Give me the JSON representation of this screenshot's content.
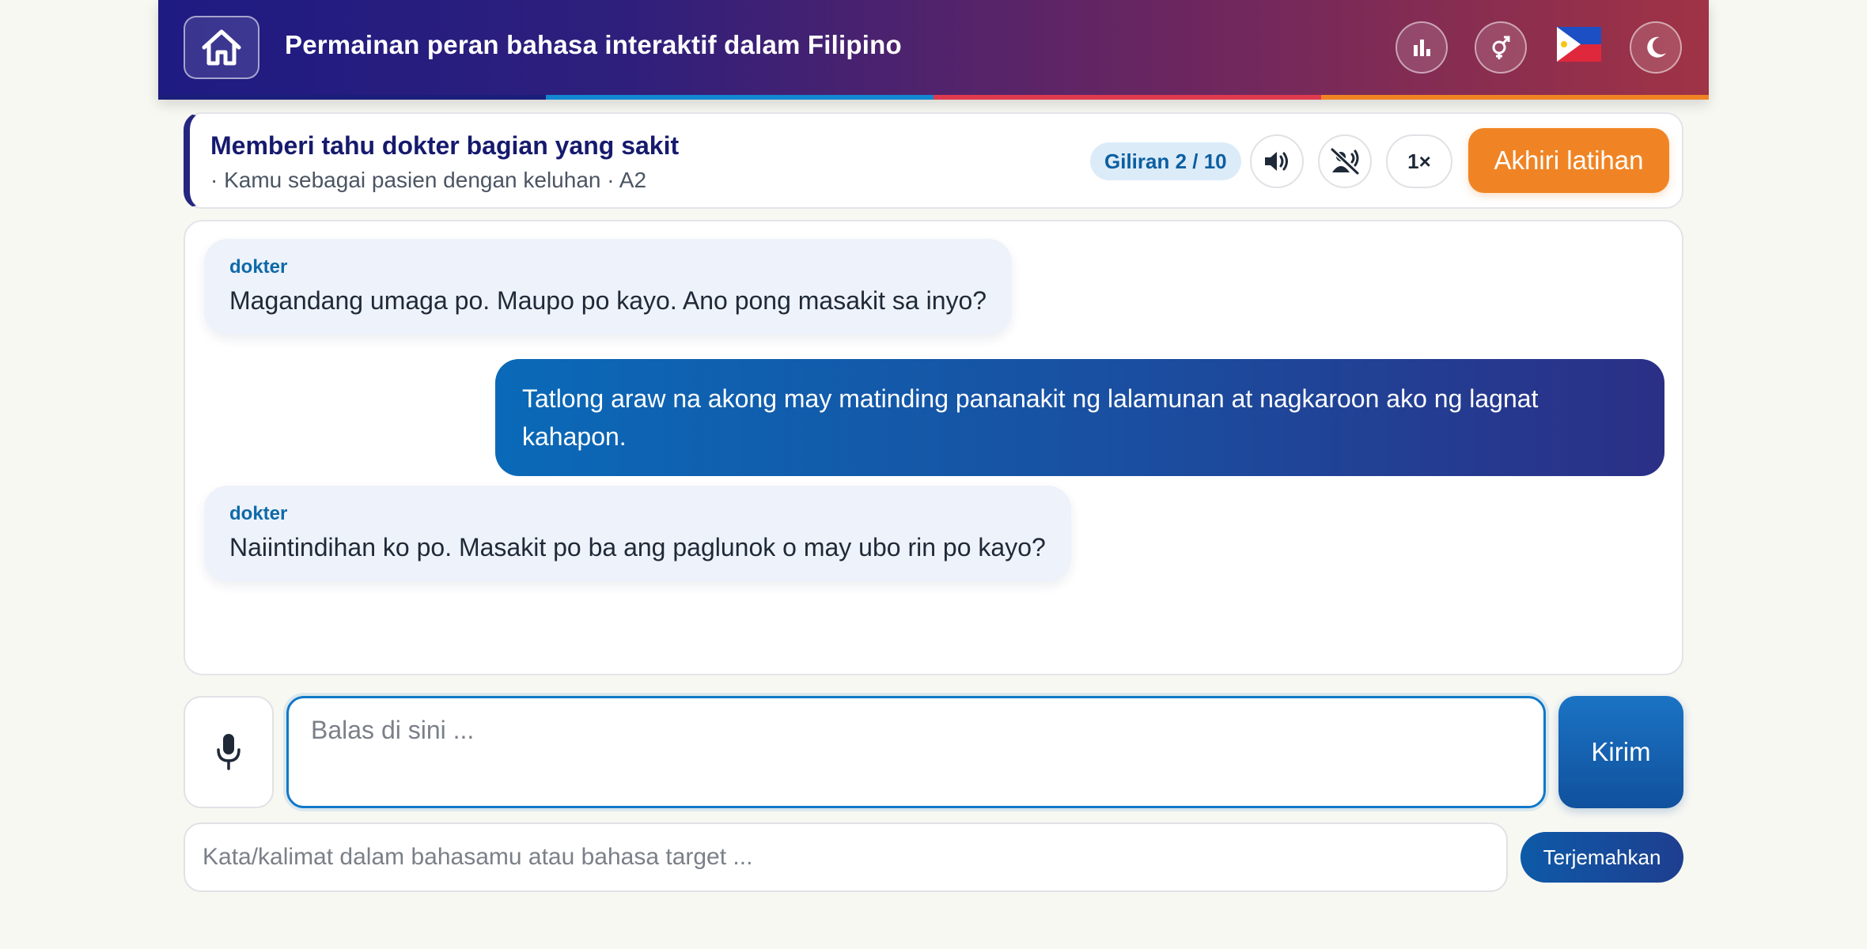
{
  "header": {
    "title": "Permainan peran bahasa interaktif dalam Filipino",
    "icons": [
      "home-icon",
      "bar-chart-icon",
      "gender-icon",
      "philippines-flag-icon",
      "moon-icon"
    ],
    "stripe_colors": [
      "#1c1f7a",
      "#1387d1",
      "#e03a4e",
      "#f08424"
    ]
  },
  "scenario": {
    "title": "Memberi tahu dokter bagian yang sakit",
    "subtitle": "· Kamu sebagai pasien dengan keluhan · A2",
    "turn": "Giliran 2 / 10",
    "speed": "1×",
    "end_label": "Akhiri latihan"
  },
  "chat": {
    "messages": [
      {
        "role": "bot",
        "speaker": "dokter",
        "text": "Magandang umaga po. Maupo po kayo. Ano pong masakit sa inyo?"
      },
      {
        "role": "user",
        "text": "Tatlong araw na akong may matinding pananakit ng lalamunan at nagkaroon ako ng lagnat kahapon."
      },
      {
        "role": "bot",
        "speaker": "dokter",
        "text": "Naiintindihan ko po. Masakit po ba ang paglunok o may ubo rin po kayo?"
      }
    ]
  },
  "composer": {
    "reply_placeholder": "Balas di sini ...",
    "send_label": "Kirim",
    "translate_placeholder": "Kata/kalimat dalam bahasamu atau bahasa target ...",
    "translate_label": "Terjemahkan"
  },
  "colors": {
    "accent_blue": "#1178c8",
    "accent_orange": "#f08424",
    "navy": "#161a6e"
  }
}
